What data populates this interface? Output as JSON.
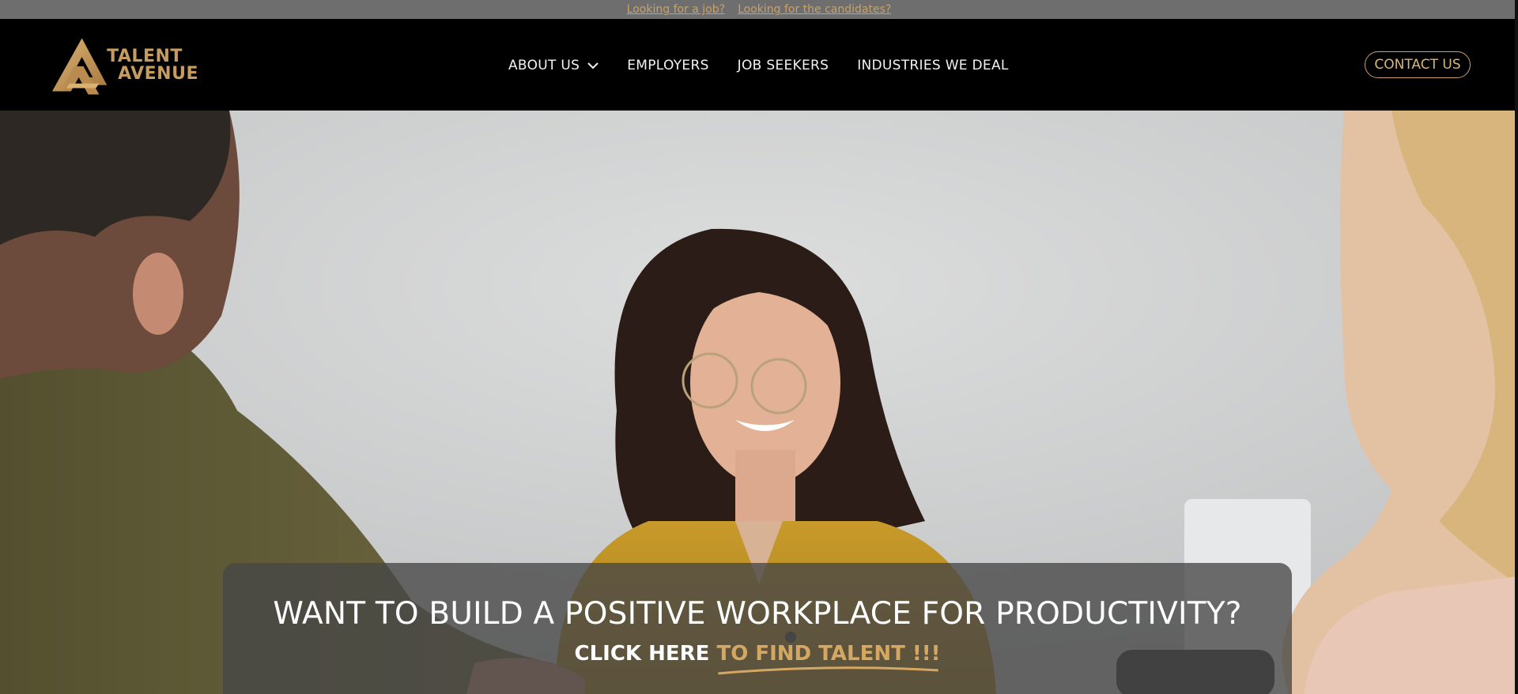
{
  "topbar": {
    "link_job": "Looking for a job?",
    "link_candidates": "Looking for the candidates?"
  },
  "header": {
    "logo": {
      "line1": "TALENT",
      "line2": "AVENUE"
    },
    "nav": [
      {
        "label": "ABOUT US",
        "has_dropdown": true
      },
      {
        "label": "EMPLOYERS"
      },
      {
        "label": "JOB SEEKERS"
      },
      {
        "label": "INDUSTRIES WE DEAL"
      }
    ],
    "contact_label": "CONTACT US"
  },
  "hero": {
    "headline": "WANT TO BUILD A POSITIVE WORKPLACE FOR PRODUCTIVITY?",
    "cta_prefix": "CLICK HERE",
    "cta_link": "TO FIND TALENT !!!"
  },
  "colors": {
    "accent_gold": "#c9a26a",
    "header_bg": "#000000",
    "topbar_bg": "#6e6e6e"
  },
  "icons": {
    "logo": "talent-avenue-logo-icon",
    "dropdown": "chevron-down-icon"
  }
}
